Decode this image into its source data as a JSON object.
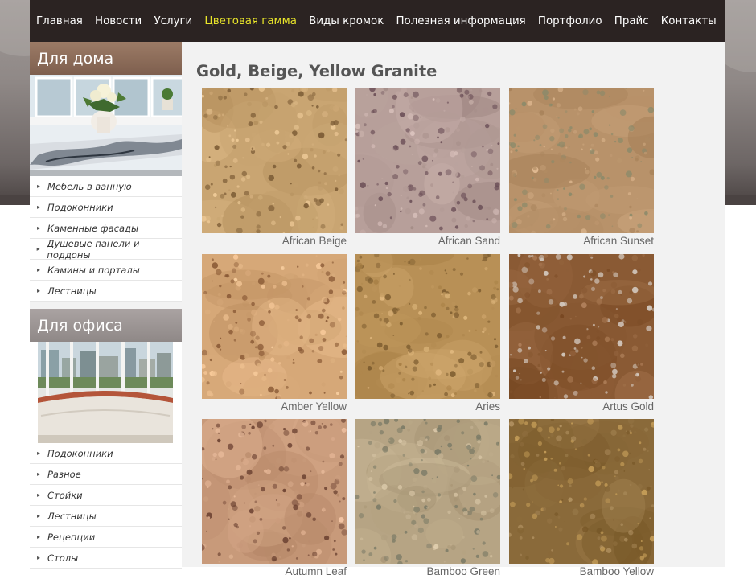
{
  "nav": {
    "items": [
      {
        "label": "Главная",
        "active": false
      },
      {
        "label": "Новости",
        "active": false
      },
      {
        "label": "Услуги",
        "active": false
      },
      {
        "label": "Цветовая гамма",
        "active": true
      },
      {
        "label": "Виды кромок",
        "active": false
      },
      {
        "label": "Полезная информация",
        "active": false
      },
      {
        "label": "Портфолио",
        "active": false
      },
      {
        "label": "Прайс",
        "active": false
      },
      {
        "label": "Контакты",
        "active": false
      }
    ],
    "active_color": "#e9e52a"
  },
  "sidebar": {
    "home": {
      "title": "Для дома",
      "items": [
        "Мебель в ванную",
        "Подоконники",
        "Каменные фасады",
        "Душевые панели и поддоны",
        "Камины и порталы",
        "Лестницы"
      ]
    },
    "office": {
      "title": "Для офиса",
      "items": [
        "Подоконники",
        "Разное",
        "Стойки",
        "Лестницы",
        "Рецепции",
        "Столы"
      ]
    }
  },
  "main": {
    "heading": "Gold, Beige, Yellow Granite",
    "tiles": [
      {
        "name": "African Beige",
        "base": "#c9a572",
        "spot": "#7a5a34"
      },
      {
        "name": "African Sand",
        "base": "#b79f9a",
        "spot": "#6b4f57"
      },
      {
        "name": "African Sunset",
        "base": "#b8926a",
        "spot": "#8a8a6a"
      },
      {
        "name": "Amber Yellow",
        "base": "#d6a878",
        "spot": "#8a5a36"
      },
      {
        "name": "Aries",
        "base": "#b89056",
        "spot": "#7a5a2e"
      },
      {
        "name": "Artus Gold",
        "base": "#8a5a34",
        "spot": "#d8d0c8"
      },
      {
        "name": "Autumn Leaf",
        "base": "#c89a7a",
        "spot": "#6a4030"
      },
      {
        "name": "Bamboo Green",
        "base": "#b6a484",
        "spot": "#7a7a66"
      },
      {
        "name": "Bamboo Yellow",
        "base": "#8a6a3a",
        "spot": "#c8a05a"
      }
    ]
  }
}
